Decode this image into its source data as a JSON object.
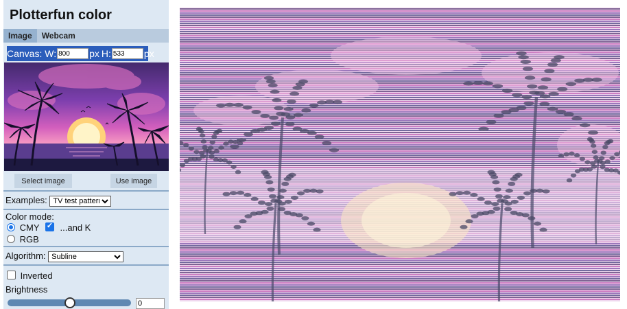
{
  "app": {
    "title": "Plotterfun color"
  },
  "tabs": [
    {
      "label": "Image",
      "active": true
    },
    {
      "label": "Webcam",
      "active": false
    }
  ],
  "canvas": {
    "label": "Canvas: W:",
    "width": "800",
    "unit": "px",
    "h_label": "H:",
    "height": "533"
  },
  "buttons": {
    "select_image": "Select image",
    "use_image": "Use image"
  },
  "examples": {
    "label": "Examples:",
    "selected": "TV test pattern"
  },
  "color_mode": {
    "label": "Color mode:",
    "options": [
      {
        "label": "CMY",
        "selected": true
      },
      {
        "label": "RGB",
        "selected": false
      }
    ],
    "and_k": {
      "label": "...and K",
      "checked": true
    }
  },
  "algorithm": {
    "label": "Algorithm:",
    "selected": "Subline"
  },
  "inverted": {
    "label": "Inverted",
    "checked": false
  },
  "brightness": {
    "label": "Brightness",
    "value": "0",
    "fraction": 0.5
  },
  "colors": {
    "panel": "#dde8f3",
    "accent": "#2b5dbb",
    "output_bg": "#efd7ee"
  },
  "icons": {
    "image_preview": "sunset-palm-trees-image",
    "output": "plotted-line-art-canvas"
  }
}
